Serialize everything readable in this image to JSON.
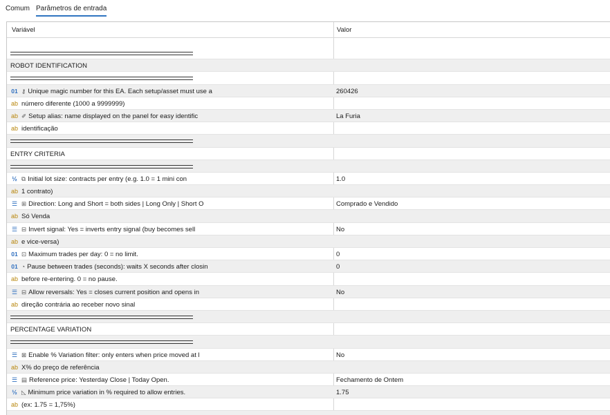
{
  "tabs": [
    {
      "label": "Comum"
    },
    {
      "label": "Parâmetros de entrada"
    }
  ],
  "grid": {
    "col_variable": "Variável",
    "col_value": "Valor",
    "rows": [
      {
        "type": "sep"
      },
      {
        "type": "section",
        "name": "ROBOT IDENTIFICATION"
      },
      {
        "type": "sep"
      },
      {
        "type": "param",
        "icon": "int",
        "sub": "key",
        "name": "Unique magic number for this EA. Each setup/asset must use a",
        "value": "260426"
      },
      {
        "type": "param",
        "icon": "str",
        "name": "número diferente (1000 a 9999999)",
        "value": ""
      },
      {
        "type": "param",
        "icon": "str",
        "sub": "tag",
        "name": "Setup alias: name displayed on the panel for easy identific",
        "value": "La Furia"
      },
      {
        "type": "param",
        "icon": "str",
        "name": "identificação",
        "value": ""
      },
      {
        "type": "sep"
      },
      {
        "type": "section",
        "name": "ENTRY CRITERIA"
      },
      {
        "type": "sep"
      },
      {
        "type": "param",
        "icon": "dbl",
        "sub": "box",
        "name": "Initial lot size: contracts per entry (e.g. 1.0 = 1 mini con",
        "value": "1.0"
      },
      {
        "type": "param",
        "icon": "str",
        "name": "1 contrato)",
        "value": ""
      },
      {
        "type": "param",
        "icon": "enm",
        "sub": "dir",
        "name": "Direction: Long and Short = both sides | Long Only | Short O",
        "value": "Comprado e Vendido"
      },
      {
        "type": "param",
        "icon": "str",
        "name": "Só Venda",
        "value": ""
      },
      {
        "type": "param",
        "icon": "enm",
        "sub": "inv",
        "name": "Invert signal: Yes = inverts entry signal (buy becomes sell",
        "value": "No"
      },
      {
        "type": "param",
        "icon": "str",
        "name": "e vice-versa)",
        "value": ""
      },
      {
        "type": "param",
        "icon": "int",
        "sub": "max",
        "name": "Maximum trades per day: 0 = no limit.",
        "value": "0"
      },
      {
        "type": "param",
        "icon": "int",
        "sub": "clk",
        "name": "Pause between trades (seconds): waits X seconds after closin",
        "value": "0"
      },
      {
        "type": "param",
        "icon": "str",
        "name": "before re-entering. 0 = no pause.",
        "value": ""
      },
      {
        "type": "param",
        "icon": "enm",
        "sub": "rev",
        "name": "Allow reversals: Yes = closes current position and opens in",
        "value": "No"
      },
      {
        "type": "param",
        "icon": "str",
        "name": "direção contrária ao receber novo sinal",
        "value": ""
      },
      {
        "type": "sep"
      },
      {
        "type": "section",
        "name": "PERCENTAGE VARIATION"
      },
      {
        "type": "sep"
      },
      {
        "type": "param",
        "icon": "enm",
        "sub": "flt",
        "name": "Enable % Variation filter: only enters when price moved at l",
        "value": "No"
      },
      {
        "type": "param",
        "icon": "str",
        "name": "X% do preço de referência",
        "value": ""
      },
      {
        "type": "param",
        "icon": "enm",
        "sub": "ref",
        "name": "Reference price: Yesterday Close | Today Open.",
        "value": "Fechamento de Ontem"
      },
      {
        "type": "param",
        "icon": "dbl",
        "sub": "chr",
        "name": "Minimum price variation in % required to allow entries.",
        "value": "1.75"
      },
      {
        "type": "param",
        "icon": "str",
        "name": "(ex: 1.75 = 1,75%)",
        "value": ""
      },
      {
        "type": "sep"
      }
    ]
  },
  "icons": {
    "int": "01",
    "str": "ab",
    "dbl": "½",
    "enm": "☰",
    "key": "⚷",
    "tag": "✐",
    "box": "⧉",
    "dir": "⊞",
    "inv": "⊟",
    "max": "⊡",
    "clk": "◔",
    "rev": "⊟",
    "flt": "⊠",
    "ref": "▤",
    "chr": "◺"
  }
}
